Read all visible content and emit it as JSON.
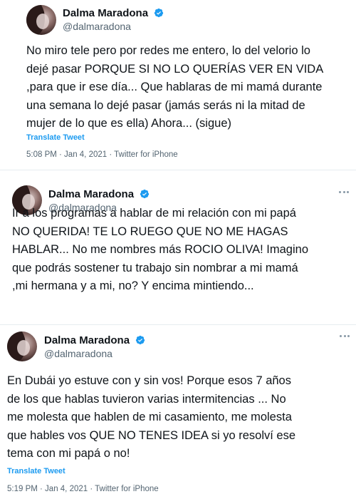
{
  "colors": {
    "verified": "#1d9bf0",
    "link": "#1d9bf0",
    "muted": "#536471"
  },
  "tweets": [
    {
      "author": "Dalma Maradona",
      "handle": "@dalmaradona",
      "lines": [
        "No miro tele pero por redes me entero, lo del velorio lo",
        "dejé pasar PORQUE SI NO LO QUERÍAS VER EN VIDA",
        ",para que ir ese día... Que hablaras de mi mamá durante",
        "una semana lo dejé pasar (jamás serás ni la mitad de",
        "mujer de lo que es ella) Ahora... (sigue)"
      ],
      "translate": "Translate Tweet",
      "meta": "5:08 PM · Jan 4, 2021 · Twitter for iPhone"
    },
    {
      "author": "Dalma Maradona",
      "handle": "@dalmaradona",
      "lines": [
        "Ir a los programas a hablar de mi relación con mi papá",
        "NO QUERIDA! TE LO RUEGO QUE NO ME HAGAS",
        "HABLAR... No me nombres más ROCIO OLIVA! Imagino",
        "que podrás sostener tu trabajo sin nombrar a mi mamá",
        ",mi hermana y a mi, no? Y encima mintiendo..."
      ]
    },
    {
      "author": "Dalma Maradona",
      "handle": "@dalmaradona",
      "lines": [
        "En Dubái yo estuve con y sin vos! Porque esos 7 años",
        "de los que hablas tuvieron varias intermitencias ...  No",
        "me molesta que hablen de mi casamiento, me molesta",
        "que hables vos QUE NO TENES IDEA si yo resolví ese",
        "tema con mi papá o no!"
      ],
      "translate": "Translate Tweet",
      "meta": "5:19 PM · Jan 4, 2021 · Twitter for iPhone"
    }
  ]
}
